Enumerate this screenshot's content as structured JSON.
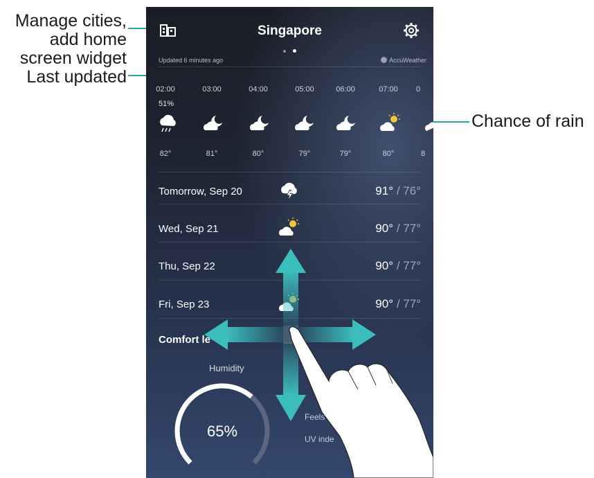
{
  "callouts": {
    "manage_line1": "Manage cities,",
    "manage_line2": "add home",
    "manage_line3": "screen widget",
    "last_updated": "Last updated",
    "chance_of_rain": "Chance of rain"
  },
  "header": {
    "city": "Singapore",
    "updated": "Updated 6 minutes ago",
    "provider": "AccuWeather"
  },
  "hourly": {
    "rain_chance": "51%",
    "hours": [
      {
        "time": "02:00",
        "icon": "rain-icon",
        "temp": "82°"
      },
      {
        "time": "03:00",
        "icon": "moon-cloud-icon",
        "temp": "81°"
      },
      {
        "time": "04:00",
        "icon": "moon-cloud-icon",
        "temp": "80°"
      },
      {
        "time": "05:00",
        "icon": "moon-cloud-icon",
        "temp": "79°"
      },
      {
        "time": "06:00",
        "icon": "moon-cloud-icon",
        "temp": "79°"
      },
      {
        "time": "07:00",
        "icon": "sun-cloud-icon",
        "temp": "80°"
      },
      {
        "time": "0",
        "icon": "cloud-icon",
        "temp": "8"
      }
    ]
  },
  "daily": [
    {
      "day": "Tomorrow, Sep 20",
      "icon": "thunderstorm-icon",
      "high": "91°",
      "low": "/ 76°"
    },
    {
      "day": "Wed, Sep 21",
      "icon": "sun-cloud-icon",
      "high": "90°",
      "low": "/ 77°"
    },
    {
      "day": "Thu, Sep 22",
      "icon": "sun-cloud-icon",
      "high": "90°",
      "low": "/ 77°"
    },
    {
      "day": "Fri, Sep 23",
      "icon": "sun-cloud-icon",
      "high": "90°",
      "low": "/ 77°"
    }
  ],
  "comfort": {
    "title": "Comfort le",
    "humidity_label": "Humidity",
    "humidity_value": "65%",
    "humidity_fraction": 0.65,
    "feels_like": "Feels lik",
    "uv_index": "UV inde"
  },
  "colors": {
    "accent": "#2aa6a0",
    "arrow": "#3bbdbd"
  }
}
